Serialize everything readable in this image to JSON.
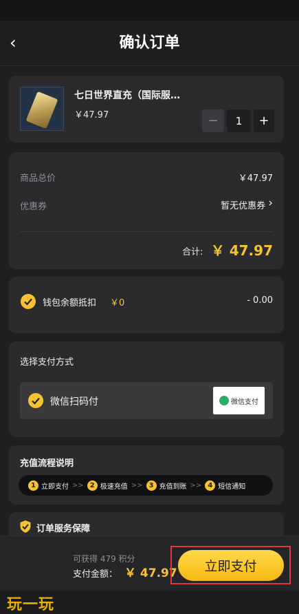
{
  "header": {
    "title": "确认订单",
    "back_icon": "‹"
  },
  "product": {
    "name": "七日世界直充（国际服…",
    "price": "￥47.97",
    "minus": "−",
    "quantity": "1",
    "plus": "+"
  },
  "summary": {
    "goods_total_label": "商品总价",
    "goods_total_value": "￥47.97",
    "coupon_label": "优惠券",
    "coupon_value": "暂无优惠券",
    "coupon_arrow": "›",
    "total_label": "合计:",
    "total_value": "￥ 47.97"
  },
  "wallet": {
    "label": "钱包余额抵扣",
    "amount": "￥0",
    "deduction": "- 0.00"
  },
  "payment": {
    "section_title": "选择支付方式",
    "method": "微信扫码付",
    "logo_text": "微信支付"
  },
  "process": {
    "title": "充值流程说明",
    "steps": [
      {
        "num": "1",
        "label": "立即支付"
      },
      {
        "num": "2",
        "label": "极速充值"
      },
      {
        "num": "3",
        "label": "充值到账"
      },
      {
        "num": "4",
        "label": "短信通知"
      }
    ],
    "separator": ">>"
  },
  "guarantee": {
    "title": "订单服务保障"
  },
  "footer": {
    "points": "可获得 479 积分",
    "amount_label": "支付金额：",
    "amount_value": "￥ 47.97",
    "pay_button": "立即支付"
  },
  "watermark": "玩一玩",
  "colors": {
    "accent": "#f5c230",
    "bg": "#1f1f21",
    "card": "#2b2b2e",
    "highlight": "#e53935"
  }
}
